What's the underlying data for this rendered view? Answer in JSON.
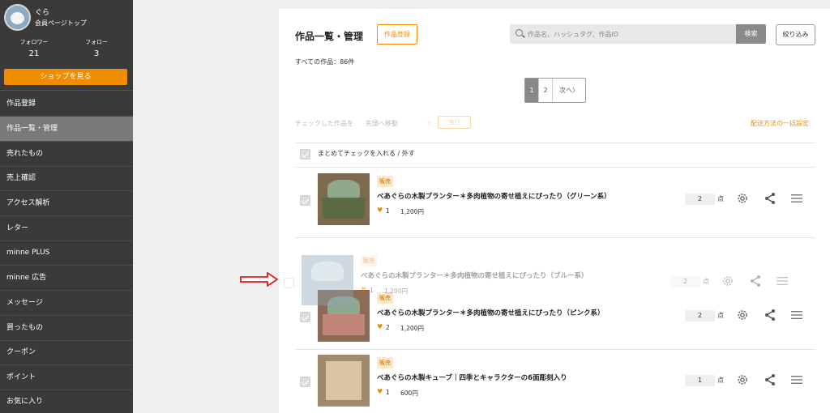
{
  "sidebar": {
    "user_name": "ぐら",
    "mypage_label": "会員ページトップ",
    "followers_label": "フォロワー",
    "followers_count": "21",
    "following_label": "フォロー",
    "following_count": "3",
    "shop_button": "ショップを見る",
    "items": [
      {
        "label": "作品登録"
      },
      {
        "label": "作品一覧・管理"
      },
      {
        "label": "売れたもの"
      },
      {
        "label": "売上確認"
      },
      {
        "label": "アクセス解析"
      },
      {
        "label": "レター"
      },
      {
        "label": "minne PLUS"
      },
      {
        "label": "minne 広告"
      },
      {
        "label": "メッセージ"
      },
      {
        "label": "買ったもの"
      },
      {
        "label": "クーポン"
      },
      {
        "label": "ポイント"
      },
      {
        "label": "お気に入り"
      }
    ]
  },
  "header": {
    "title": "作品一覧・管理",
    "register_button": "作品登録",
    "search_placeholder": "作品名、ハッシュタグ、作品ID",
    "search_button": "検索",
    "filter_button": "絞り込み"
  },
  "total_label": "すべての作品：86件",
  "pagination": {
    "current": "1",
    "page2": "2",
    "next": "次へ〉"
  },
  "bulk": {
    "label": "チェックした作品を",
    "select_value": "先頭へ移動",
    "exec_button": "実行",
    "shipping_link": "配送方法の一括設定",
    "select_all_label": "まとめてチェックを入れる / 外す"
  },
  "products": [
    {
      "tag": "販売",
      "name": "べあぐらの木製プランター＊多肉植物の寄せ植えにぴったり（グリーン系）",
      "likes": "1",
      "price": "1,200円",
      "qty": "2",
      "unit": "点"
    },
    {
      "tag": "販売",
      "name": "べあぐらの木製プランター＊多肉植物の寄せ植えにぴったり（ピンク系）",
      "likes": "2",
      "price": "1,200円",
      "qty": "2",
      "unit": "点"
    },
    {
      "tag": "販売",
      "name": "べあぐらの木製キューブ｜四季とキャラクターの6面彫刻入り",
      "likes": "1",
      "price": "600円",
      "qty": "1",
      "unit": "点"
    }
  ],
  "dragging": {
    "tag": "販売",
    "name": "べあぐらの木製プランター＊多肉植物の寄せ植えにぴったり（ブルー系）",
    "likes": "1",
    "price": "1,200円",
    "qty": "2",
    "unit": "点"
  },
  "colors": {
    "accent": "#f08c00",
    "sidebar_bg": "#3a3a3a",
    "arrow": "#e21b1b"
  }
}
